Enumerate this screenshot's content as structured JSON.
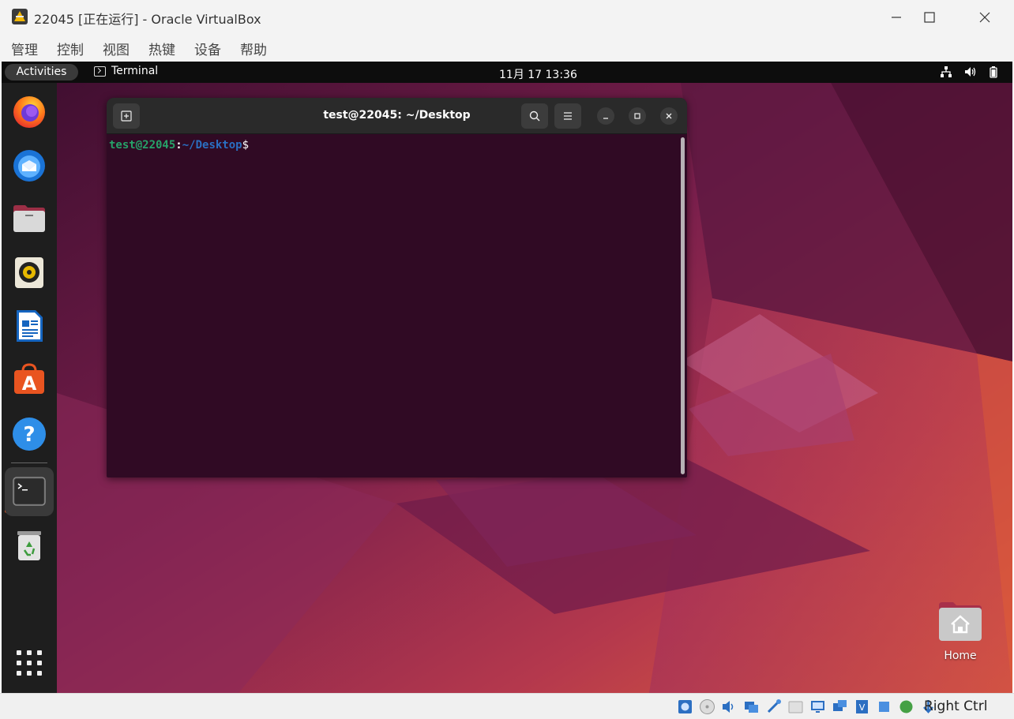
{
  "window": {
    "title": "22045 [正在运行] - Oracle VirtualBox",
    "menu": [
      "管理",
      "控制",
      "视图",
      "热键",
      "设备",
      "帮助"
    ]
  },
  "topbar": {
    "activities": "Activities",
    "app_name": "Terminal",
    "clock": "11月 17  13:36"
  },
  "dock": {
    "items": [
      "firefox-icon",
      "thunderbird-icon",
      "files-icon",
      "rhythmbox-icon",
      "libreoffice-writer-icon",
      "app-center-icon",
      "help-icon",
      "terminal-icon",
      "trash-icon"
    ],
    "show_apps_icon": "grid-icon"
  },
  "terminal": {
    "title": "test@22045: ~/Desktop",
    "prompt_user": "test@22045",
    "prompt_colon": ":",
    "prompt_path": "~/Desktop",
    "prompt_symbol": "$"
  },
  "desktop": {
    "home_label": "Home"
  },
  "statusbar": {
    "host_key": "Right Ctrl"
  },
  "colors": {
    "terminal_bg": "#300a24",
    "prompt_user": "#26a269",
    "prompt_path": "#2a6fc2",
    "accent": "#e95420"
  }
}
